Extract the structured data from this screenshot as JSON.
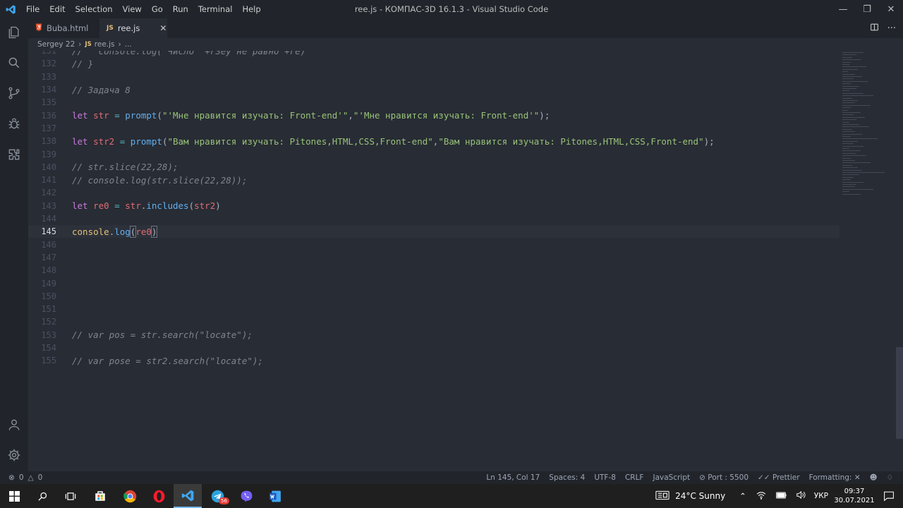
{
  "window": {
    "title": "ree.js - КОМПАС-3D 16.1.3 - Visual Studio Code",
    "menu": [
      "File",
      "Edit",
      "Selection",
      "View",
      "Go",
      "Run",
      "Terminal",
      "Help"
    ]
  },
  "tabs": [
    {
      "label": "Buba.html",
      "icon": "html5-icon",
      "icon_color": "#e44d26"
    },
    {
      "label": "ree.js",
      "icon_text": "JS",
      "icon_color": "#e5c07b",
      "active": true
    }
  ],
  "breadcrumb": {
    "folder": "Sergey 22",
    "file_icon": "JS",
    "file": "ree.js",
    "more": "..."
  },
  "editor": {
    "current_line": "145",
    "lines": [
      {
        "n": "131",
        "tokens": [
          {
            "t": "//   console.log(\"Число \"+rSey не равно\"+re)",
            "c": "cm"
          }
        ]
      },
      {
        "n": "132",
        "tokens": [
          {
            "t": "// }",
            "c": "cm"
          }
        ]
      },
      {
        "n": "133",
        "tokens": []
      },
      {
        "n": "134",
        "tokens": [
          {
            "t": "// Задача 8",
            "c": "cm"
          }
        ]
      },
      {
        "n": "135",
        "tokens": []
      },
      {
        "n": "136",
        "tokens": [
          {
            "t": "let ",
            "c": "kw"
          },
          {
            "t": "str",
            "c": "vr"
          },
          {
            "t": " = ",
            "c": "op"
          },
          {
            "t": "prompt",
            "c": "fn"
          },
          {
            "t": "(",
            "c": "pn"
          },
          {
            "t": "\"'Мне нравится изучать: Front-end'\"",
            "c": "st"
          },
          {
            "t": ",",
            "c": "pn"
          },
          {
            "t": "\"'Мне нравится изучать: Front-end'\"",
            "c": "st"
          },
          {
            "t": ");",
            "c": "pn"
          }
        ]
      },
      {
        "n": "137",
        "tokens": []
      },
      {
        "n": "138",
        "tokens": [
          {
            "t": "let ",
            "c": "kw"
          },
          {
            "t": "str2",
            "c": "vr"
          },
          {
            "t": " = ",
            "c": "op"
          },
          {
            "t": "prompt",
            "c": "fn"
          },
          {
            "t": "(",
            "c": "pn"
          },
          {
            "t": "\"Вам нравится изучать: Pitones,HTML,CSS,Front-end\"",
            "c": "st"
          },
          {
            "t": ",",
            "c": "pn"
          },
          {
            "t": "\"Вам нравится изучать: Pitones,HTML,CSS,Front-end\"",
            "c": "st"
          },
          {
            "t": ");",
            "c": "pn"
          }
        ]
      },
      {
        "n": "139",
        "tokens": []
      },
      {
        "n": "140",
        "tokens": [
          {
            "t": "// str.slice(22,28);",
            "c": "cm"
          }
        ]
      },
      {
        "n": "141",
        "tokens": [
          {
            "t": "// console.log(str.slice(22,28));",
            "c": "cm"
          }
        ]
      },
      {
        "n": "142",
        "tokens": []
      },
      {
        "n": "143",
        "tokens": [
          {
            "t": "let ",
            "c": "kw"
          },
          {
            "t": "re0",
            "c": "vr"
          },
          {
            "t": " = ",
            "c": "op"
          },
          {
            "t": "str",
            "c": "vr"
          },
          {
            "t": ".",
            "c": "pn"
          },
          {
            "t": "includes",
            "c": "fn"
          },
          {
            "t": "(",
            "c": "pn"
          },
          {
            "t": "str2",
            "c": "vr"
          },
          {
            "t": ")",
            "c": "pn"
          }
        ]
      },
      {
        "n": "144",
        "tokens": []
      },
      {
        "n": "145",
        "tokens": [
          {
            "t": "console",
            "c": "pr"
          },
          {
            "t": ".",
            "c": "pn"
          },
          {
            "t": "log",
            "c": "fn"
          },
          {
            "t": "(",
            "c": "pn bracket-hl"
          },
          {
            "t": "re0",
            "c": "vr"
          },
          {
            "t": ")",
            "c": "pn bracket-hl"
          }
        ]
      },
      {
        "n": "146",
        "tokens": []
      },
      {
        "n": "147",
        "tokens": []
      },
      {
        "n": "148",
        "tokens": []
      },
      {
        "n": "149",
        "tokens": []
      },
      {
        "n": "150",
        "tokens": []
      },
      {
        "n": "151",
        "tokens": []
      },
      {
        "n": "152",
        "tokens": []
      },
      {
        "n": "153",
        "tokens": [
          {
            "t": "// var pos = str.search(\"locate\");",
            "c": "cm"
          }
        ]
      },
      {
        "n": "154",
        "tokens": []
      },
      {
        "n": "155",
        "tokens": [
          {
            "t": "// var pose = str2.search(\"locate\");",
            "c": "cm"
          }
        ]
      }
    ]
  },
  "statusbar": {
    "errors": "0",
    "warnings": "0",
    "position": "Ln 145, Col 17",
    "spaces": "Spaces: 4",
    "encoding": "UTF-8",
    "eol": "CRLF",
    "language": "JavaScript",
    "port": "Port : 5500",
    "prettier": "Prettier",
    "formatting": "Formatting:"
  },
  "taskbar": {
    "weather": "24°C  Sunny",
    "lang": "УКР",
    "time": "09:37",
    "date": "30.07.2021",
    "telegram_badge": "56"
  },
  "colors": {
    "accent": "#007acc",
    "editor_bg": "#282c34",
    "chrome_bg": "#21252b"
  }
}
